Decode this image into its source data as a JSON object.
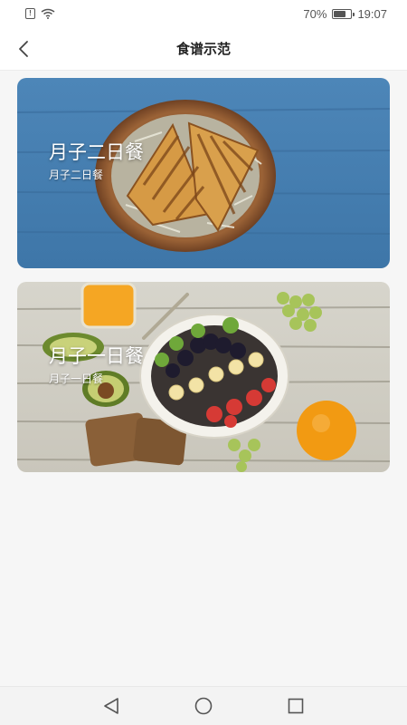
{
  "status_bar": {
    "battery_text": "70%",
    "battery_level": 0.7,
    "time": "19:07",
    "icons": [
      "sim-icon",
      "wifi-icon",
      "battery-icon"
    ]
  },
  "header": {
    "title": "食谱示范",
    "back_icon": "chevron-left-icon"
  },
  "recipes": [
    {
      "title": "月子二日餐",
      "subtitle": "月子二日餐",
      "image": "sandwich-on-blue-wood"
    },
    {
      "title": "月子一日餐",
      "subtitle": "月子一日餐",
      "image": "fruit-bowl-on-white-wood"
    }
  ],
  "nav_bar": {
    "icons": [
      "back-triangle-icon",
      "home-circle-icon",
      "recents-square-icon"
    ]
  },
  "colors": {
    "background": "#f6f6f6",
    "header_bg": "#ffffff",
    "card_text": "#ffffff"
  }
}
